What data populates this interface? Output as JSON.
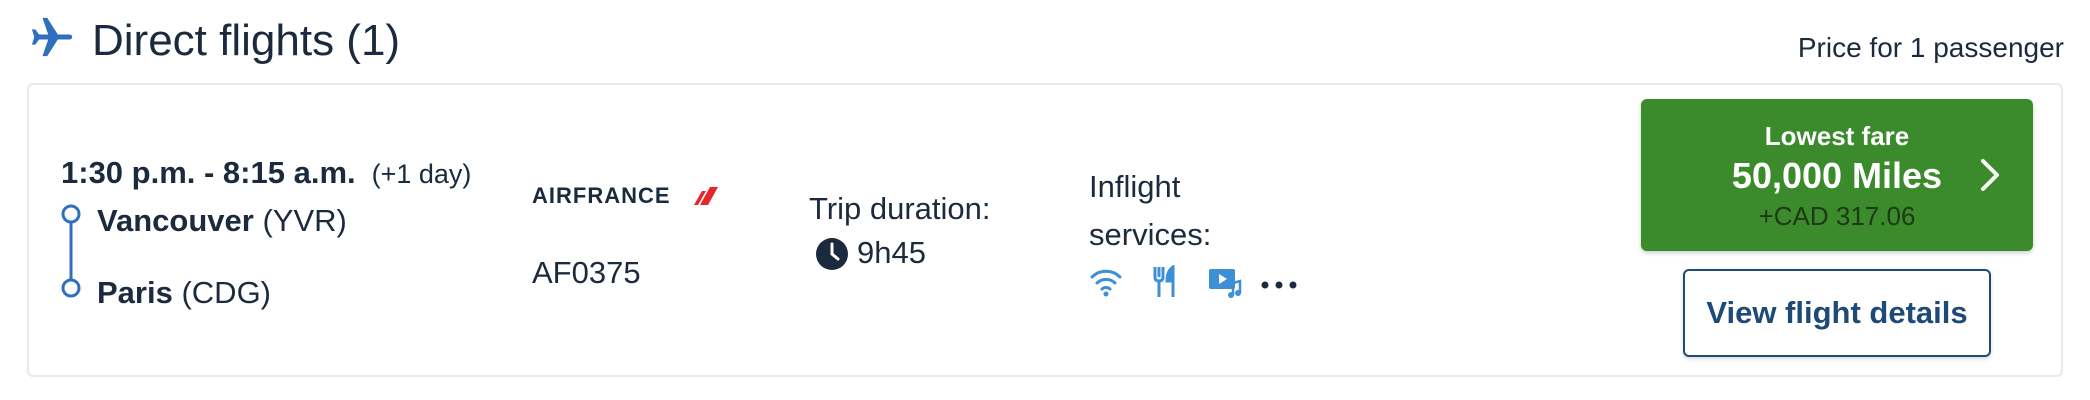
{
  "header": {
    "title": "Direct flights (1)",
    "price_note": "Price for 1 passenger",
    "icon": "plane-icon"
  },
  "flight": {
    "times": "1:30 p.m. - 8:15 a.m.",
    "day_offset": "(+1 day)",
    "origin": {
      "city": "Vancouver",
      "code": "(YVR)"
    },
    "destination": {
      "city": "Paris",
      "code": "(CDG)"
    },
    "airline": "AIRFRANCE",
    "flight_number": "AF0375",
    "duration_label": "Trip duration:",
    "duration_value": "9h45",
    "services_label": "Inflight services:",
    "services": [
      "wifi-icon",
      "meal-icon",
      "entertainment-icon",
      "more-icon"
    ]
  },
  "fare": {
    "label": "Lowest fare",
    "miles": "50,000 Miles",
    "cash": "+CAD 317.06"
  },
  "details_button": "View flight details",
  "colors": {
    "accent_blue": "#2f6fbd",
    "fare_green": "#3b8a2b",
    "airfrance_red": "#e4262b",
    "text_dark": "#1b2b3d",
    "button_blue": "#1e4a78"
  }
}
